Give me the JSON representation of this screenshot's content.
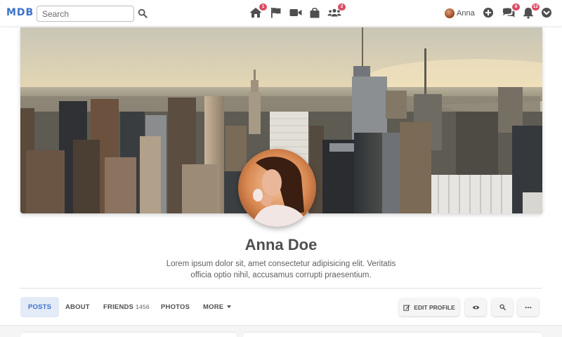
{
  "navbar": {
    "logo": "MDB",
    "search_placeholder": "Search",
    "icons": {
      "home": {
        "name": "home-icon",
        "badge": "1"
      },
      "flag": {
        "name": "flag-icon",
        "badge": ""
      },
      "video": {
        "name": "video-icon",
        "badge": ""
      },
      "shop": {
        "name": "shopping-bag-icon",
        "badge": ""
      },
      "groups": {
        "name": "users-icon",
        "badge": "2"
      }
    },
    "user_name": "Anna",
    "right_icons": {
      "plus": {
        "name": "plus-circle-icon",
        "badge": ""
      },
      "messages": {
        "name": "comments-icon",
        "badge": "6"
      },
      "notifications": {
        "name": "bell-icon",
        "badge": "12"
      },
      "menu": {
        "name": "chevron-down-circle-icon",
        "badge": ""
      }
    }
  },
  "profile": {
    "name": "Anna Doe",
    "bio": "Lorem ipsum dolor sit, amet consectetur adipisicing elit. Veritatis officia optio nihil, accusamus corrupti praesentium."
  },
  "tabs": [
    {
      "label": "Posts",
      "count": "",
      "active": true
    },
    {
      "label": "About",
      "count": ""
    },
    {
      "label": "Friends",
      "count": "1456"
    },
    {
      "label": "Photos",
      "count": ""
    },
    {
      "label": "More",
      "count": ""
    }
  ],
  "actions": {
    "edit_profile": "Edit profile"
  },
  "colors": {
    "primary": "#3b71ca",
    "badge": "#dc4c64",
    "active_tab_bg": "#e3ebf7"
  }
}
